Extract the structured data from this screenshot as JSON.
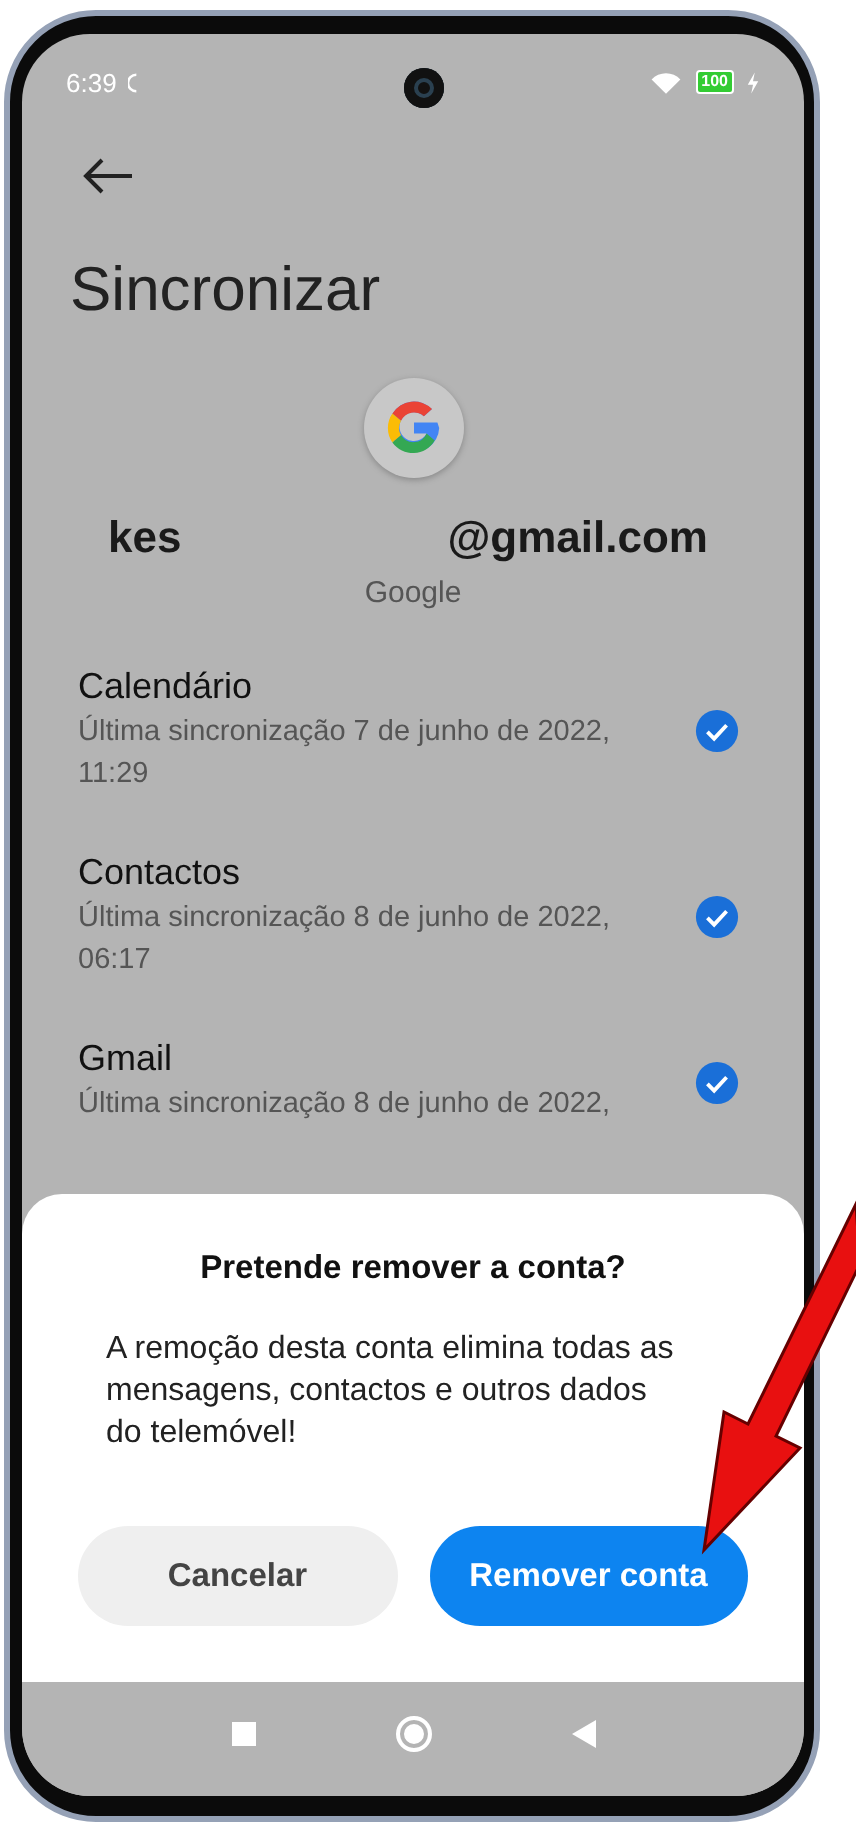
{
  "status_bar": {
    "time": "6:39",
    "battery": "100"
  },
  "header": {
    "title": "Sincronizar"
  },
  "account": {
    "name_start": "kes",
    "name_end": "@gmail.com",
    "provider": "Google"
  },
  "sync_items": [
    {
      "title": "Calendário",
      "subtitle": "Última sincronização 7 de junho de 2022, 11:29",
      "checked": true
    },
    {
      "title": "Contactos",
      "subtitle": "Última sincronização 8 de junho de 2022, 06:17",
      "checked": true
    },
    {
      "title": "Gmail",
      "subtitle": "Última sincronização 8 de junho de 2022,",
      "checked": true
    }
  ],
  "dialog": {
    "title": "Pretende remover a conta?",
    "message": "A remoção desta conta elimina todas as mensagens, contactos e outros dados do telemóvel!",
    "buttons": [
      {
        "label": "Cancelar",
        "kind": "secondary"
      },
      {
        "label": "Remover conta",
        "kind": "primary"
      }
    ]
  }
}
